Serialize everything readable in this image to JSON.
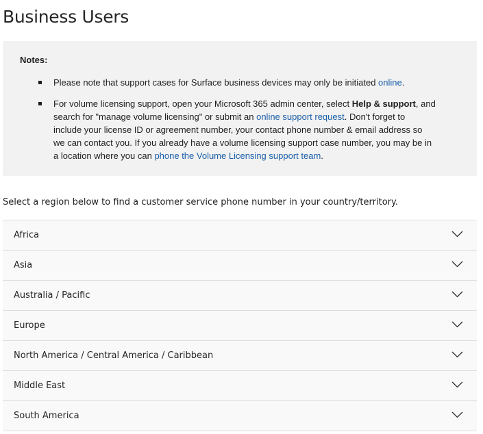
{
  "page": {
    "title": "Business Users"
  },
  "notes": {
    "heading": "Notes:",
    "item1": {
      "text": "Please note that support cases for Surface business devices may only be initiated ",
      "link": "online",
      "end": "."
    },
    "item2": {
      "part1": "For volume licensing support, open your Microsoft 365 admin center, select ",
      "bold": "Help & support",
      "part2": ", and search for \"manage volume licensing\" or submit an ",
      "link1": "online support request",
      "part3": ". Don't forget to include your license ID or agreement number, your contact phone number & email address so we can contact you. If you already have a volume licensing support case number, you may be in a location where you can ",
      "link2": "phone the Volume Licensing support team",
      "end": "."
    }
  },
  "intro": "Select a region below to find a customer service phone number in your country/territory.",
  "regions": [
    "Africa",
    "Asia",
    "Australia / Pacific",
    "Europe",
    "North America / Central America / Caribbean",
    "Middle East",
    "South America"
  ],
  "colors": {
    "link": "#1a5ea8",
    "notes_bg": "#f2f2f2",
    "accordion_bg": "#f9f9f9",
    "border": "#dcdcdc"
  },
  "icons": {
    "expand": "chevron-down-icon",
    "bullet": "square-bullet-icon"
  }
}
